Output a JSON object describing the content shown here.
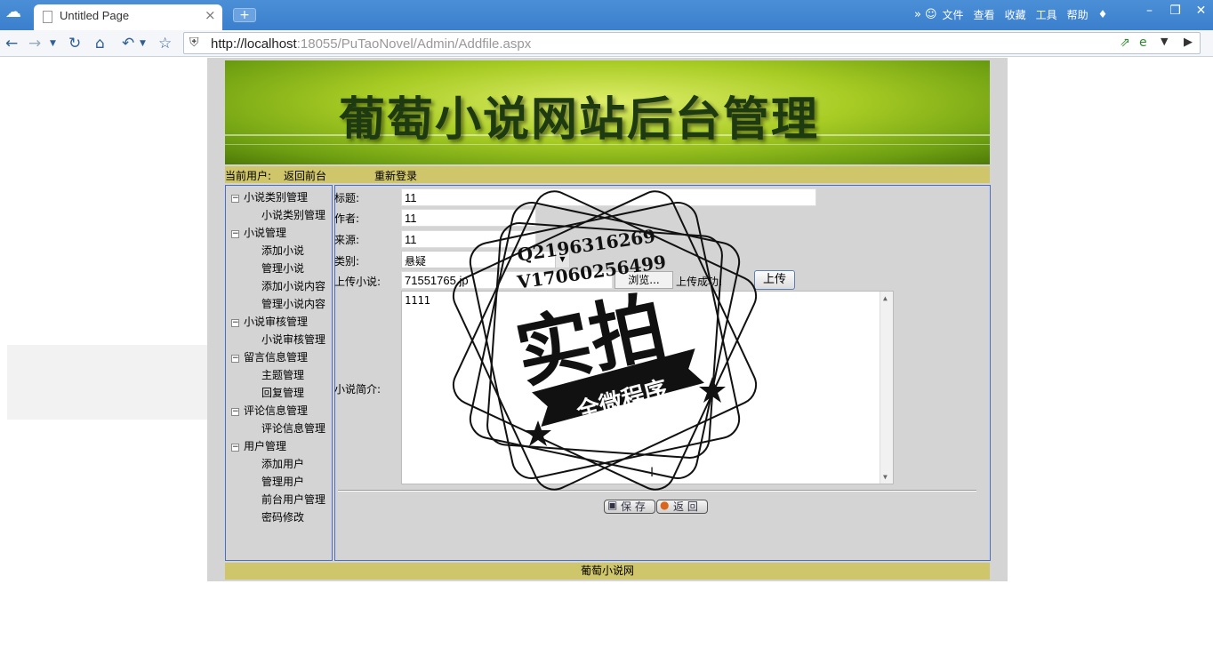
{
  "browser": {
    "tab_title": "Untitled Page",
    "url_host": "http://localhost",
    "url_rest": ":18055/PuTaoNovel/Admin/Addfile.aspx",
    "menu": [
      "文件",
      "查看",
      "收藏",
      "工具",
      "帮助"
    ],
    "more_glyph": "»"
  },
  "banner": {
    "title": "葡萄小说网站后台管理"
  },
  "userbar": {
    "current_user": "当前用户:",
    "back_front": "返回前台",
    "relogin": "重新登录"
  },
  "sidebar": {
    "groups": [
      {
        "label": "小说类别管理",
        "items": [
          "小说类别管理"
        ]
      },
      {
        "label": "小说管理",
        "items": [
          "添加小说",
          "管理小说",
          "添加小说内容",
          "管理小说内容"
        ]
      },
      {
        "label": "小说审核管理",
        "items": [
          "小说审核管理"
        ]
      },
      {
        "label": "留言信息管理",
        "items": [
          "主题管理",
          "回复管理"
        ]
      },
      {
        "label": "评论信息管理",
        "items": [
          "评论信息管理"
        ]
      },
      {
        "label": "用户管理",
        "items": [
          "添加用户",
          "管理用户",
          "前台用户管理",
          "密码修改"
        ]
      }
    ]
  },
  "form": {
    "title_label": "标题:",
    "title_value": "11",
    "author_label": "作者:",
    "author_value": "11",
    "source_label": "来源:",
    "source_value": "11",
    "category_label": "类别:",
    "category_value": "悬疑",
    "upload_label": "上传小说:",
    "upload_value": "71551765.jp",
    "browse_label": "浏览...",
    "upload_status": "上传成功!",
    "upload_button": "上传",
    "intro_label": "小说简介:",
    "intro_value": "1111",
    "save_button": "保 存",
    "back_button": "返 回"
  },
  "footer": {
    "text": "葡萄小说网"
  },
  "watermark": {
    "line1": "Q2196316269",
    "line2": "V17060256499",
    "big": "实拍",
    "ribbon": "全微程序"
  }
}
